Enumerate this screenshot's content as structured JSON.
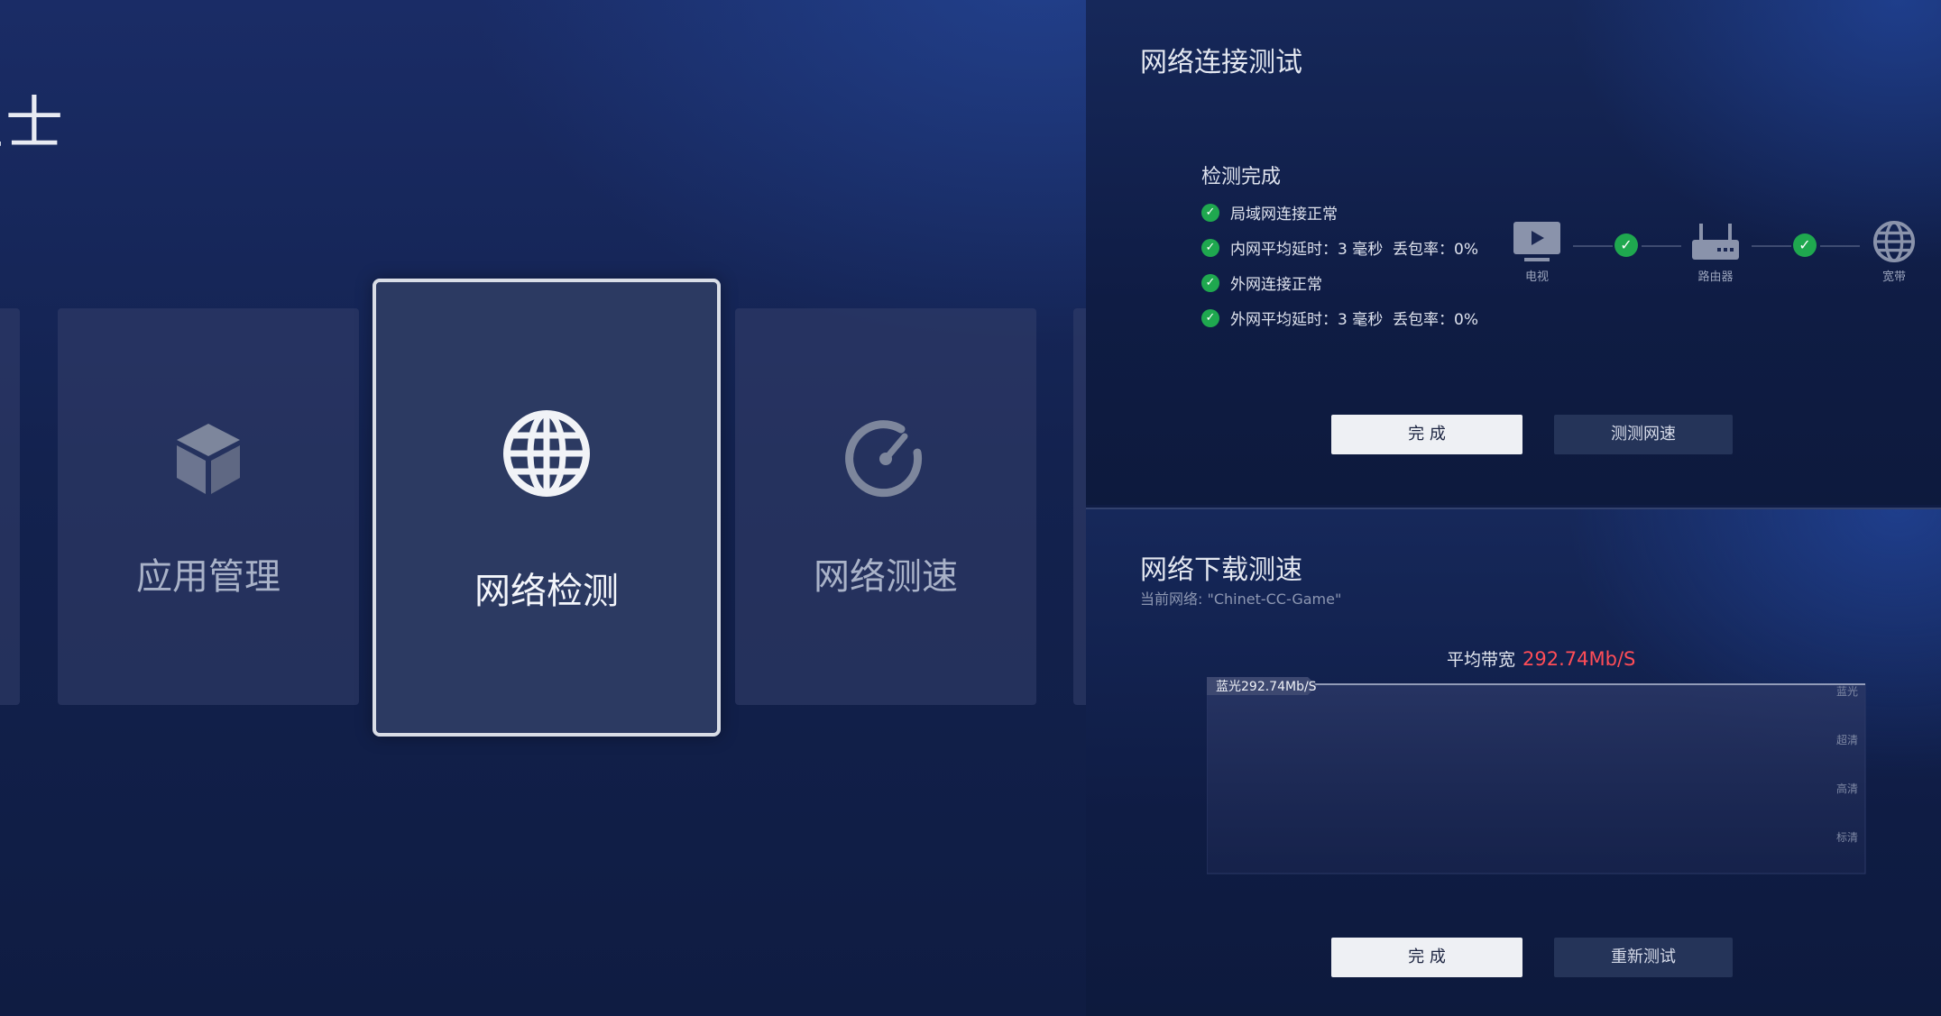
{
  "left": {
    "title": "卫士",
    "tiles": [
      {
        "label": "应用管理",
        "icon": "cube-icon"
      },
      {
        "label": "网络检测",
        "icon": "globe-icon",
        "focused": true
      },
      {
        "label": "网络测速",
        "icon": "speedometer-icon"
      }
    ]
  },
  "connection_test": {
    "title": "网络连接测试",
    "status": "检测完成",
    "checks": [
      "局域网连接正常",
      "内网平均延时：3 毫秒  丢包率：0%",
      "外网连接正常",
      "外网平均延时：3 毫秒  丢包率：0%"
    ],
    "nodes": [
      "电视",
      "路由器",
      "宽带"
    ],
    "buttons": {
      "done": "完 成",
      "speed": "测测网速"
    }
  },
  "download_test": {
    "title": "网络下载测速",
    "network": "当前网络: \"Chinet-CC-Game\"",
    "avg_label": "平均带宽",
    "avg_value": "292.74Mb/S",
    "marker": "蓝光292.74Mb/S",
    "levels": [
      "蓝光",
      "超清",
      "高清",
      "标清"
    ],
    "buttons": {
      "done": "完 成",
      "retest": "重新测试"
    }
  },
  "colors": {
    "ok": "#1fa84f",
    "highlight": "#ff4d57"
  }
}
